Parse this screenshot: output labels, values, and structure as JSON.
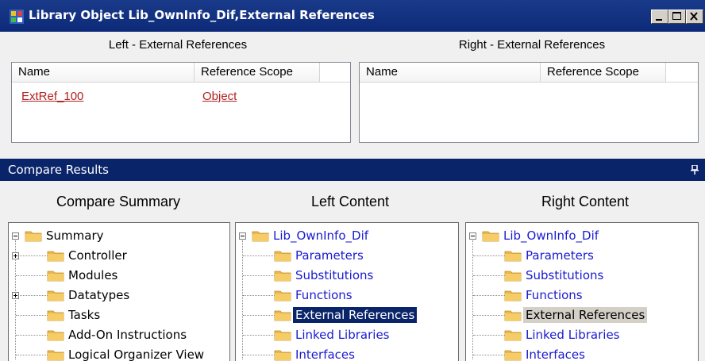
{
  "window": {
    "title": "Library Object Lib_OwnInfo_Dif,External References",
    "buttons": [
      "minimize-icon",
      "maximize-icon",
      "close-icon"
    ]
  },
  "left_pane": {
    "caption": "Left - External References",
    "columns": [
      "Name",
      "Reference Scope"
    ],
    "rows": [
      [
        "ExtRef_100",
        "Object"
      ]
    ]
  },
  "right_pane": {
    "caption": "Right - External References",
    "columns": [
      "Name",
      "Reference Scope"
    ],
    "rows": []
  },
  "results": {
    "title": "Compare Results",
    "pin_icon": "pin-icon"
  },
  "summary_tree": {
    "heading": "Compare Summary",
    "root": "Summary",
    "items": [
      "Controller",
      "Modules",
      "Datatypes",
      "Tasks",
      "Add-On Instructions",
      "Logical Organizer View"
    ]
  },
  "left_content": {
    "heading": "Left Content",
    "root": "Lib_OwnInfo_Dif",
    "items": [
      "Parameters",
      "Substitutions",
      "Functions",
      "External References",
      "Linked Libraries",
      "Interfaces"
    ],
    "selected": "External References"
  },
  "right_content": {
    "heading": "Right Content",
    "root": "Lib_OwnInfo_Dif",
    "items": [
      "Parameters",
      "Substitutions",
      "Functions",
      "External References",
      "Linked Libraries",
      "Interfaces"
    ],
    "selected": "External References"
  },
  "colors": {
    "titlebar": "#0c2a78",
    "selection": "#0a246a",
    "link": "#1a1ad0",
    "diff_red": "#b02020"
  }
}
